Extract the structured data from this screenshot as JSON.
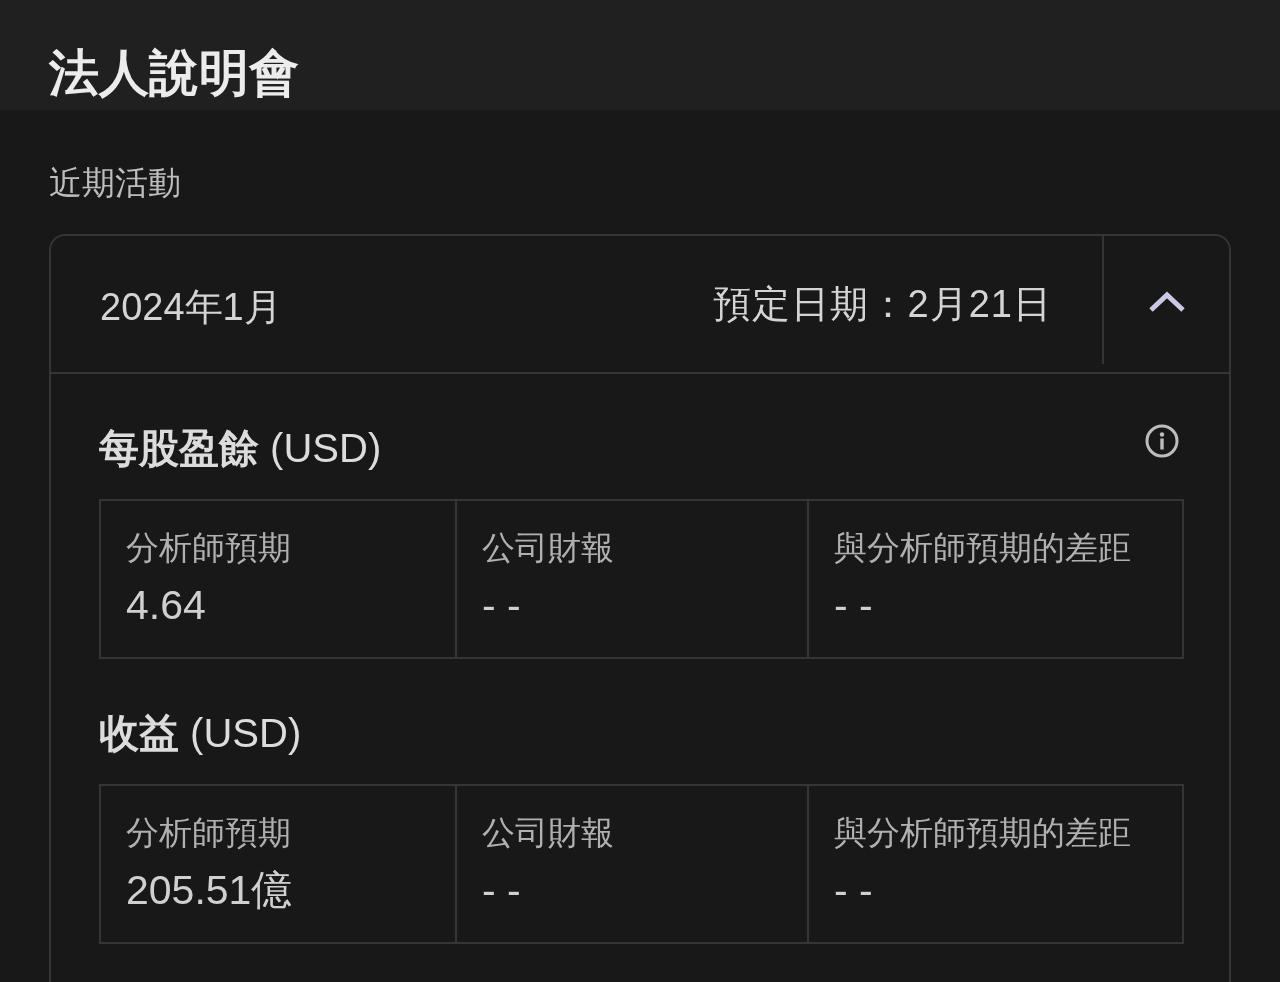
{
  "header": {
    "title": "法人說明會"
  },
  "section_label": "近期活動",
  "event": {
    "period": "2024年1月",
    "scheduled_date": "預定日期：2月21日",
    "expanded": true,
    "metrics": [
      {
        "title": "**每股盈餘** (USD)",
        "has_info": true,
        "cells": [
          {
            "label": "分析師預期",
            "value": "4.64"
          },
          {
            "label": "公司財報",
            "value": "- -"
          },
          {
            "label": "與分析師預期的差距",
            "value": "- -"
          }
        ]
      },
      {
        "title": "**收益** (USD)",
        "has_info": false,
        "cells": [
          {
            "label": "分析師預期",
            "value": "205.51億"
          },
          {
            "label": "公司財報",
            "value": "- -"
          },
          {
            "label": "與分析師預期的差距",
            "value": "- -"
          }
        ]
      }
    ]
  }
}
